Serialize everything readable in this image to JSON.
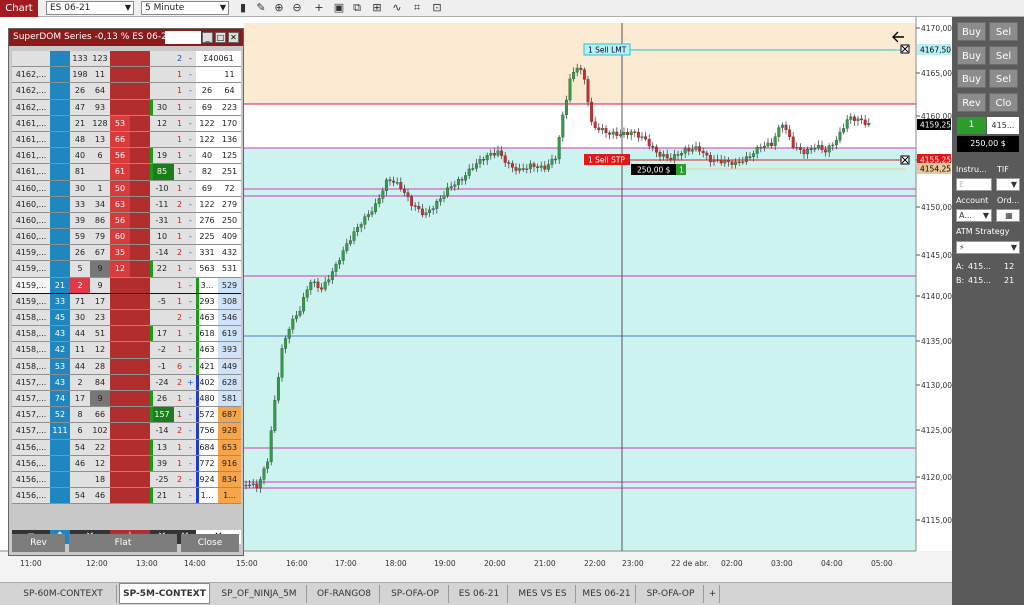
{
  "toolbar": {
    "chart_label": "Chart",
    "instrument": "ES 06-21",
    "interval": "5 Minute"
  },
  "dom": {
    "title": "SuperDOM Series -0,13 % ES 06-21",
    "header_row": {
      "c1": "133",
      "c2": "123",
      "buys": "2",
      "sells": "-",
      "right_total": "Σ40061"
    },
    "rows": [
      {
        "p": "4162,...",
        "a": "",
        "b": "198",
        "c": "11",
        "d": "",
        "e": "",
        "f": "1",
        "g": "-",
        "h": "",
        "i": "11",
        "hl": ""
      },
      {
        "p": "4162,...",
        "a": "",
        "b": "26",
        "c": "64",
        "d": "",
        "e": "",
        "f": "1",
        "g": "-",
        "h": "26",
        "i": "64",
        "hl": ""
      },
      {
        "p": "4162,...",
        "a": "",
        "b": "47",
        "c": "93",
        "d": "",
        "e": "30",
        "f": "1",
        "g": "-",
        "h": "69",
        "i": "223",
        "hl": "g"
      },
      {
        "p": "4161,...",
        "a": "",
        "b": "21",
        "c": "128",
        "d": "53",
        "e": "12",
        "f": "1",
        "g": "-",
        "h": "122",
        "i": "170",
        "hl": ""
      },
      {
        "p": "4161,...",
        "a": "",
        "b": "48",
        "c": "13",
        "d": "66",
        "e": "",
        "f": "1",
        "g": "-",
        "h": "122",
        "i": "136",
        "hl": ""
      },
      {
        "p": "4161,...",
        "a": "",
        "b": "40",
        "c": "6",
        "d": "56",
        "e": "19",
        "f": "1",
        "g": "-",
        "h": "40",
        "i": "125",
        "hl": "g"
      },
      {
        "p": "4161,...",
        "a": "",
        "b": "81",
        "c": "",
        "d": "61",
        "e": "85",
        "f": "1",
        "g": "-",
        "h": "82",
        "i": "251",
        "hl": "G"
      },
      {
        "p": "4160,...",
        "a": "",
        "b": "30",
        "c": "1",
        "d": "50",
        "e": "-10",
        "f": "1",
        "g": "-",
        "h": "69",
        "i": "72",
        "hl": ""
      },
      {
        "p": "4160,...",
        "a": "",
        "b": "33",
        "c": "34",
        "d": "63",
        "e": "-11",
        "f": "2",
        "g": "-",
        "h": "122",
        "i": "279",
        "hl": ""
      },
      {
        "p": "4160,...",
        "a": "",
        "b": "39",
        "c": "86",
        "d": "56",
        "e": "-31",
        "f": "1",
        "g": "-",
        "h": "276",
        "i": "250",
        "hl": ""
      },
      {
        "p": "4160,...",
        "a": "",
        "b": "59",
        "c": "79",
        "d": "60",
        "e": "10",
        "f": "1",
        "g": "-",
        "h": "225",
        "i": "409",
        "hl": ""
      },
      {
        "p": "4159,...",
        "a": "",
        "b": "26",
        "c": "67",
        "d": "35",
        "e": "-14",
        "f": "2",
        "g": "-",
        "h": "331",
        "i": "432",
        "hl": ""
      },
      {
        "p": "4159,...",
        "a": "",
        "b": "5",
        "c": "9",
        "d": "12",
        "e": "22",
        "f": "1",
        "g": "-",
        "h": "563",
        "i": "531",
        "hl": "g"
      },
      {
        "p": "4159,...",
        "a": "21",
        "b": "2",
        "c": "9",
        "d": "",
        "e": "",
        "f": "1",
        "g": "-",
        "h": "3...",
        "i": "529",
        "hl": "cur"
      },
      {
        "p": "4159,...",
        "a": "33",
        "b": "71",
        "c": "17",
        "d": "",
        "e": "-5",
        "f": "1",
        "g": "-",
        "h": "293",
        "i": "308",
        "hl": ""
      },
      {
        "p": "4158,...",
        "a": "45",
        "b": "30",
        "c": "23",
        "d": "",
        "e": "",
        "f": "2",
        "g": "-",
        "h": "463",
        "i": "546",
        "hl": ""
      },
      {
        "p": "4158,...",
        "a": "43",
        "b": "44",
        "c": "51",
        "d": "",
        "e": "17",
        "f": "1",
        "g": "-",
        "h": "618",
        "i": "619",
        "hl": "g"
      },
      {
        "p": "4158,...",
        "a": "42",
        "b": "11",
        "c": "12",
        "d": "",
        "e": "-2",
        "f": "1",
        "g": "-",
        "h": "463",
        "i": "393",
        "hl": ""
      },
      {
        "p": "4158,...",
        "a": "53",
        "b": "44",
        "c": "28",
        "d": "",
        "e": "-1",
        "f": "6",
        "g": "-",
        "h": "421",
        "i": "449",
        "hl": ""
      },
      {
        "p": "4157,...",
        "a": "43",
        "b": "2",
        "c": "84",
        "d": "",
        "e": "-24",
        "f": "2",
        "g": "+",
        "h": "402",
        "i": "628",
        "hl": ""
      },
      {
        "p": "4157,...",
        "a": "74",
        "b": "17",
        "c": "9",
        "d": "",
        "e": "26",
        "f": "1",
        "g": "-",
        "h": "480",
        "i": "581",
        "hl": "g"
      },
      {
        "p": "4157,...",
        "a": "52",
        "b": "8",
        "c": "66",
        "d": "",
        "e": "157",
        "f": "1",
        "g": "-",
        "h": "572",
        "i": "687",
        "hl": "G"
      },
      {
        "p": "4157,...",
        "a": "111",
        "b": "6",
        "c": "102",
        "d": "",
        "e": "-14",
        "f": "2",
        "g": "-",
        "h": "756",
        "i": "928",
        "hl": ""
      },
      {
        "p": "4156,...",
        "a": "",
        "b": "54",
        "c": "22",
        "d": "",
        "e": "13",
        "f": "1",
        "g": "-",
        "h": "684",
        "i": "653",
        "hl": "g"
      },
      {
        "p": "4156,...",
        "a": "",
        "b": "46",
        "c": "12",
        "d": "",
        "e": "39",
        "f": "1",
        "g": "-",
        "h": "772",
        "i": "916",
        "hl": "g"
      },
      {
        "p": "4156,...",
        "a": "",
        "b": "",
        "c": "18",
        "d": "",
        "e": "-25",
        "f": "2",
        "g": "-",
        "h": "924",
        "i": "834",
        "hl": ""
      },
      {
        "p": "4156,...",
        "a": "",
        "b": "54",
        "c": "46",
        "d": "",
        "e": "21",
        "f": "1",
        "g": "-",
        "h": "1...",
        "i": "1...",
        "hl": "g"
      }
    ],
    "rev_label": "Rev",
    "flat_label": "Flat",
    "close_label": "Close"
  },
  "orders": {
    "sell_lmt_label": "1 Sell LMT",
    "sell_stp_label": "1 Sell STP",
    "pnl_label": "250,00 $",
    "pnl_qty": "1"
  },
  "price_axis": {
    "ticks": [
      "4170,00",
      "4165,00",
      "4160,00",
      "4155,00",
      "4150,00",
      "4145,00",
      "4140,00",
      "4135,00",
      "4130,00",
      "4125,00",
      "4120,00",
      "4115,00"
    ],
    "markers": [
      {
        "label": "4167,50",
        "color": "#b8f0f4"
      },
      {
        "label": "4159,25",
        "color": "#000000"
      },
      {
        "label": "4155,25",
        "color": "#e11818"
      },
      {
        "label": "4154,25",
        "color": "#e9c99c"
      }
    ]
  },
  "time_axis": {
    "ticks": [
      "11:00",
      "12:00",
      "13:00",
      "14:00",
      "15:00",
      "16:00",
      "17:00",
      "18:00",
      "19:00",
      "20:00",
      "21:00",
      "22:00",
      "23:00",
      "22 de abr.",
      "02:00",
      "03:00",
      "04:00",
      "05:00"
    ]
  },
  "right_panel": {
    "buy1": "Buy",
    "sell1": "Sel",
    "buy2": "Buy",
    "sell2": "Sel",
    "buy3": "Buy",
    "sell3": "Sel",
    "rev": "Rev",
    "close": "Clo",
    "qty": "1",
    "last": "415...",
    "pnl": "250,00 $",
    "instrument_label": "Instru...",
    "tif_label": "TIF",
    "instrument_val": "E",
    "account_label": "Account",
    "order_label": "Ord...",
    "account_val": "A...",
    "atm_label": "ATM Strategy",
    "ask_label": "A:",
    "ask_price": "415...",
    "ask_qty": "12",
    "bid_label": "B:",
    "bid_price": "415...",
    "bid_qty": "21"
  },
  "tabs": [
    "SP-60M-CONTEXT",
    "SP-5M-CONTEXT",
    "SP_OF_NINJA_5M",
    "OF-RANGO8",
    "SP-OFA-OP",
    "ES 06-21",
    "MES VS ES",
    "MES 06-21",
    "SP-OFA-OP",
    "+"
  ],
  "active_tab": "SP-5M-CONTEXT"
}
